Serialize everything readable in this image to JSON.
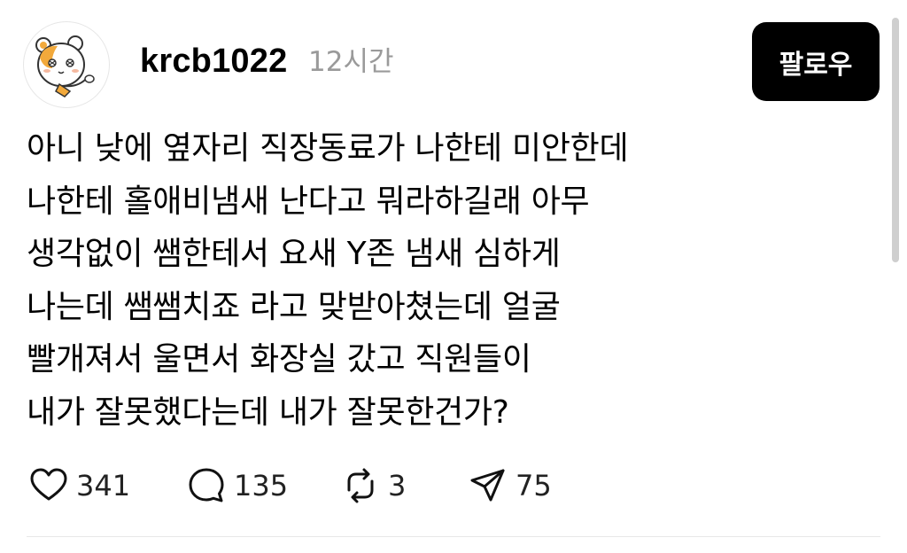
{
  "post": {
    "username": "krcb1022",
    "timestamp": "12시간",
    "follow_label": "팔로우",
    "body_lines": [
      "아니 낮에 옆자리 직장동료가 나한테 미안한데",
      "나한테 홀애비냄새 난다고 뭐라하길래 아무",
      "생각없이 쌤한테서 요새 Y존 냄새 심하게",
      "나는데 쌤쌤치죠 라고 맞받아쳤는데 얼굴",
      "빨개져서 울면서 화장실 갔고 직원들이",
      "내가 잘못했다는데 내가 잘못한건가?"
    ],
    "actions": {
      "likes": "341",
      "comments": "135",
      "reposts": "3",
      "shares": "75"
    }
  },
  "icons": {
    "avatar": "hamster-avatar",
    "like": "heart-icon",
    "comment": "comment-bubble-icon",
    "repost": "repost-icon",
    "share": "send-icon"
  },
  "colors": {
    "follow_button_bg": "#000000",
    "follow_button_text": "#ffffff",
    "timestamp": "#9a9a9a",
    "divider": "#e8e8e8"
  }
}
